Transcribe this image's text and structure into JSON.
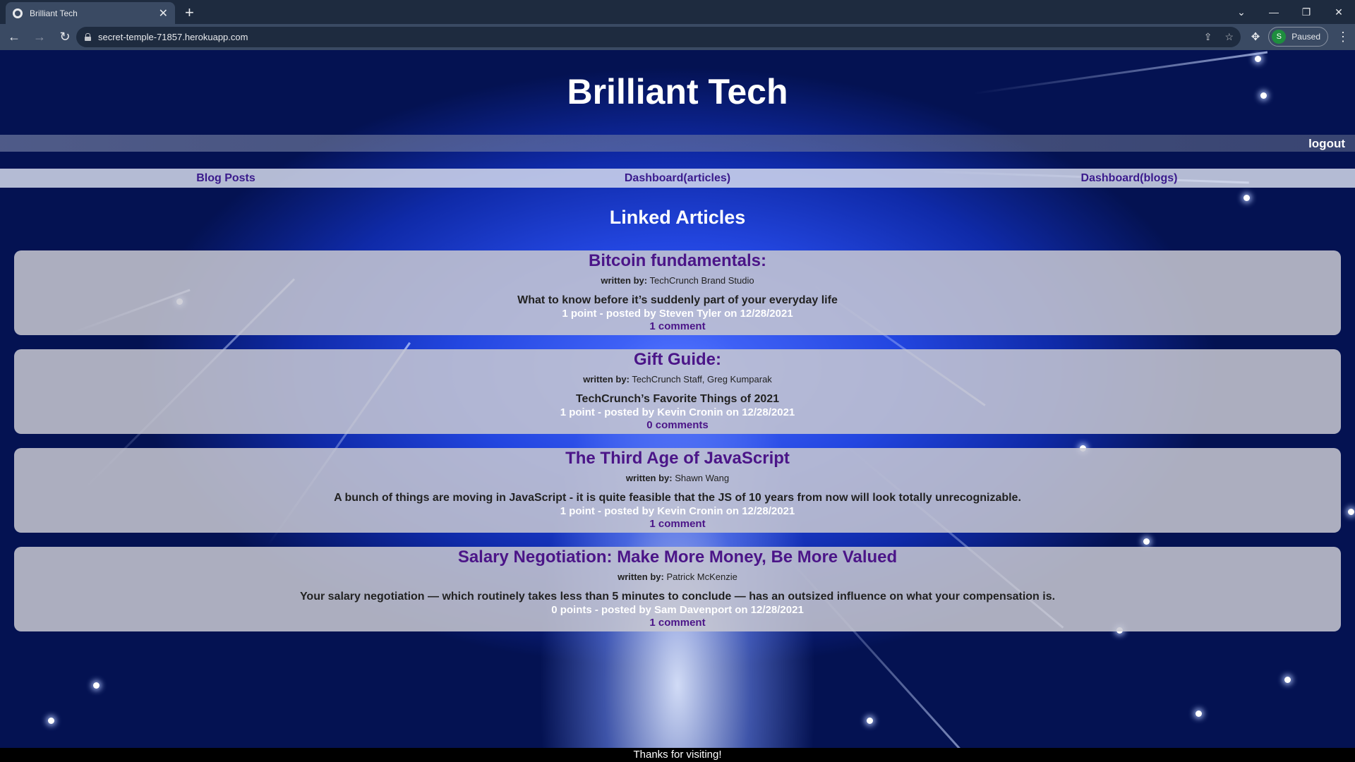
{
  "browser": {
    "tab_title": "Brilliant Tech",
    "tab_close": "✕",
    "new_tab": "+",
    "url": "secret-temple-71857.herokuapp.com",
    "profile_initial": "S",
    "profile_status": "Paused"
  },
  "site": {
    "title": "Brilliant Tech",
    "logout": "logout"
  },
  "nav": {
    "blog_posts": "Blog Posts",
    "dashboard_articles": "Dashboard(articles)",
    "dashboard_blogs": "Dashboard(blogs)"
  },
  "section_title": "Linked Articles",
  "articles": [
    {
      "title": "Bitcoin fundamentals:",
      "author_label": "written by:",
      "author": "TechCrunch Brand Studio",
      "description": "What to know before it’s suddenly part of your everyday life",
      "meta": "1 point - posted by Steven Tyler on 12/28/2021",
      "comments": "1 comment"
    },
    {
      "title": "Gift Guide:",
      "author_label": "written by:",
      "author": "TechCrunch Staff, Greg Kumparak",
      "description": "TechCrunch’s Favorite Things of 2021",
      "meta": "1 point - posted by Kevin Cronin on 12/28/2021",
      "comments": "0 comments"
    },
    {
      "title": "The Third Age of JavaScript",
      "author_label": "written by:",
      "author": "Shawn Wang",
      "description": "A bunch of things are moving in JavaScript - it is quite feasible that the JS of 10 years from now will look totally unrecognizable.",
      "meta": "1 point - posted by Kevin Cronin on 12/28/2021",
      "comments": "1 comment"
    },
    {
      "title": "Salary Negotiation: Make More Money, Be More Valued",
      "author_label": "written by:",
      "author": "Patrick McKenzie",
      "description": "Your salary negotiation — which routinely takes less than 5 minutes to conclude — has an outsized influence on what your compensation is.",
      "meta": "0 points - posted by Sam Davenport on 12/28/2021",
      "comments": "1 comment"
    }
  ],
  "footer": "Thanks for visiting!",
  "colors": {
    "link_purple": "#4b1588",
    "card_bg": "#c8c8d2",
    "chrome_dark": "#1e2b3f",
    "chrome_toolbar": "#3a4a63"
  }
}
